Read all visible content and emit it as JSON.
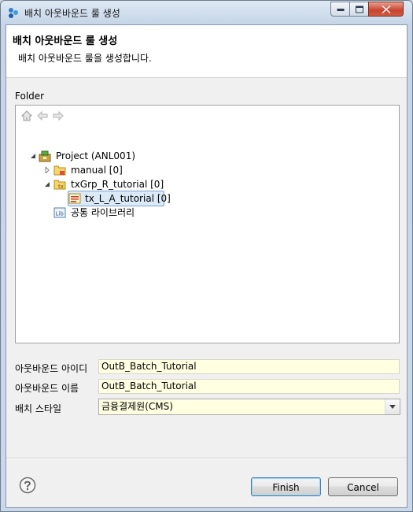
{
  "window": {
    "title": "배치 아웃바운드 룰 생성",
    "controls": [
      "minimize-icon",
      "maximize-icon",
      "close-icon"
    ]
  },
  "header": {
    "title": "배치 아웃바운드 룰 생성",
    "description": "배치 아웃바운드 룰을 생성합니다."
  },
  "folder": {
    "label": "Folder",
    "toolbar": [
      "home-icon",
      "back-arrow-icon",
      "forward-arrow-icon"
    ],
    "tree": {
      "project": "Project  (ANL001)",
      "manual": "manual [0]",
      "group": "txGrp_R_tutorial [0]",
      "selected_item": "tx_L_A_tutorial [0]",
      "library": "공통 라이브러리"
    }
  },
  "form": {
    "outbound_id_label": "아웃바운드 아이디",
    "outbound_id_value": "OutB_Batch_Tutorial",
    "outbound_name_label": "아웃바운드 이름",
    "outbound_name_value": "OutB_Batch_Tutorial",
    "batch_style_label": "배치 스타일",
    "batch_style_value": "금융결제원(CMS)"
  },
  "buttons": {
    "finish": "Finish",
    "cancel": "Cancel"
  },
  "colors": {
    "field_background": "#ffffe1",
    "selection_background": "#dceaf8",
    "selection_border": "#7da2ce",
    "close_button": "#c7432f"
  }
}
